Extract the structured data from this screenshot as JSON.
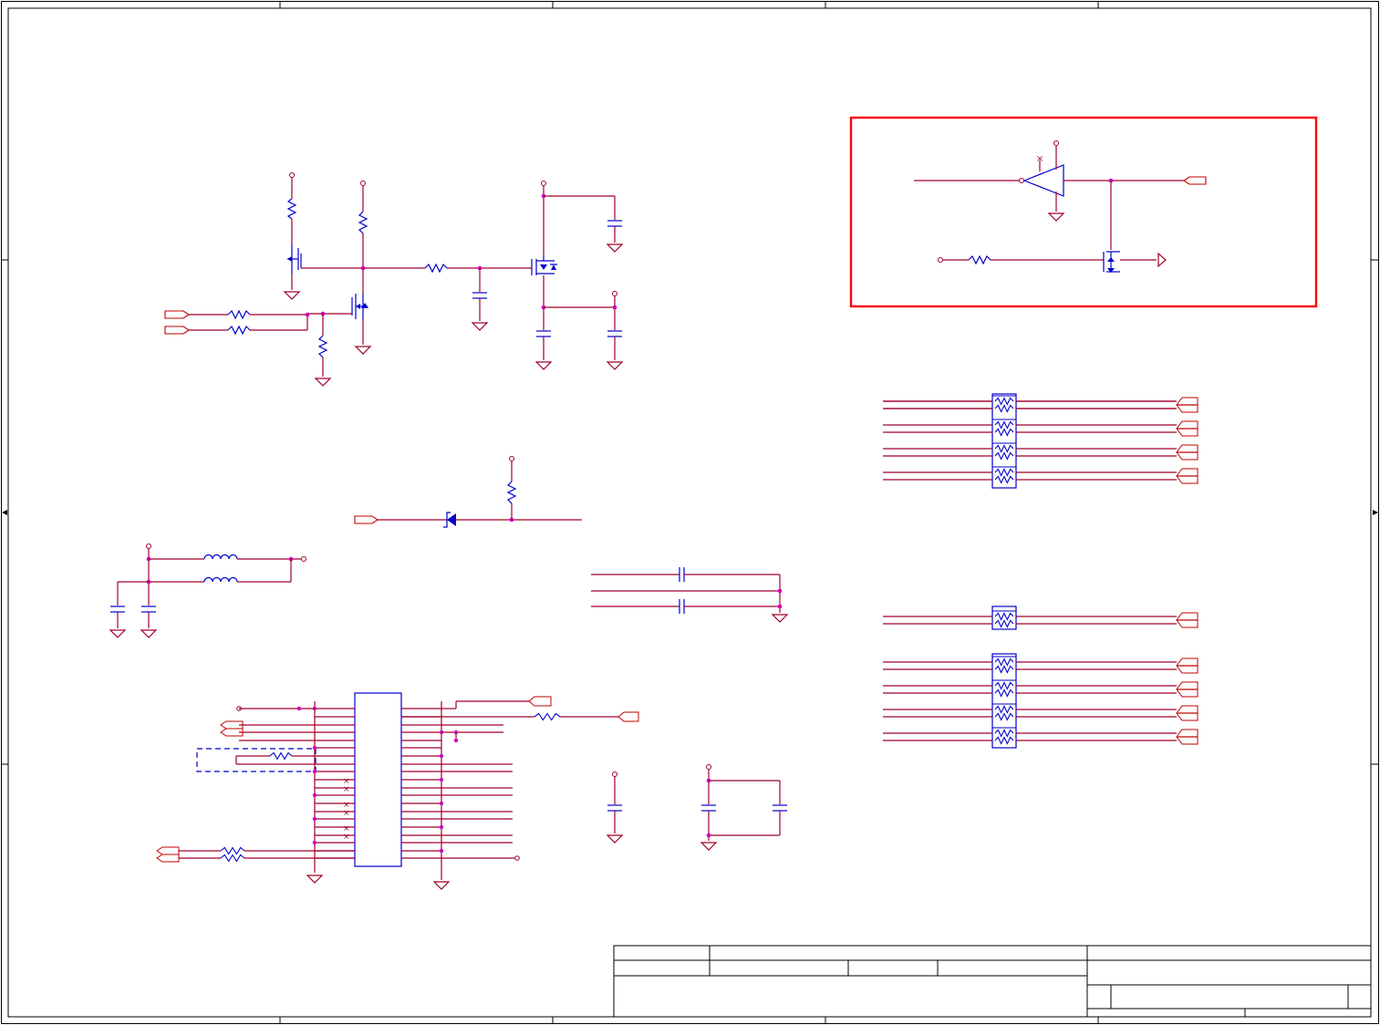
{
  "sheet": {
    "background": "#ffffff",
    "border_color": "#000000",
    "wire_color": "#a0002a",
    "part_color": "#0000cc",
    "junction_color": "#d000c0",
    "highlight_color": "#ff0000"
  }
}
